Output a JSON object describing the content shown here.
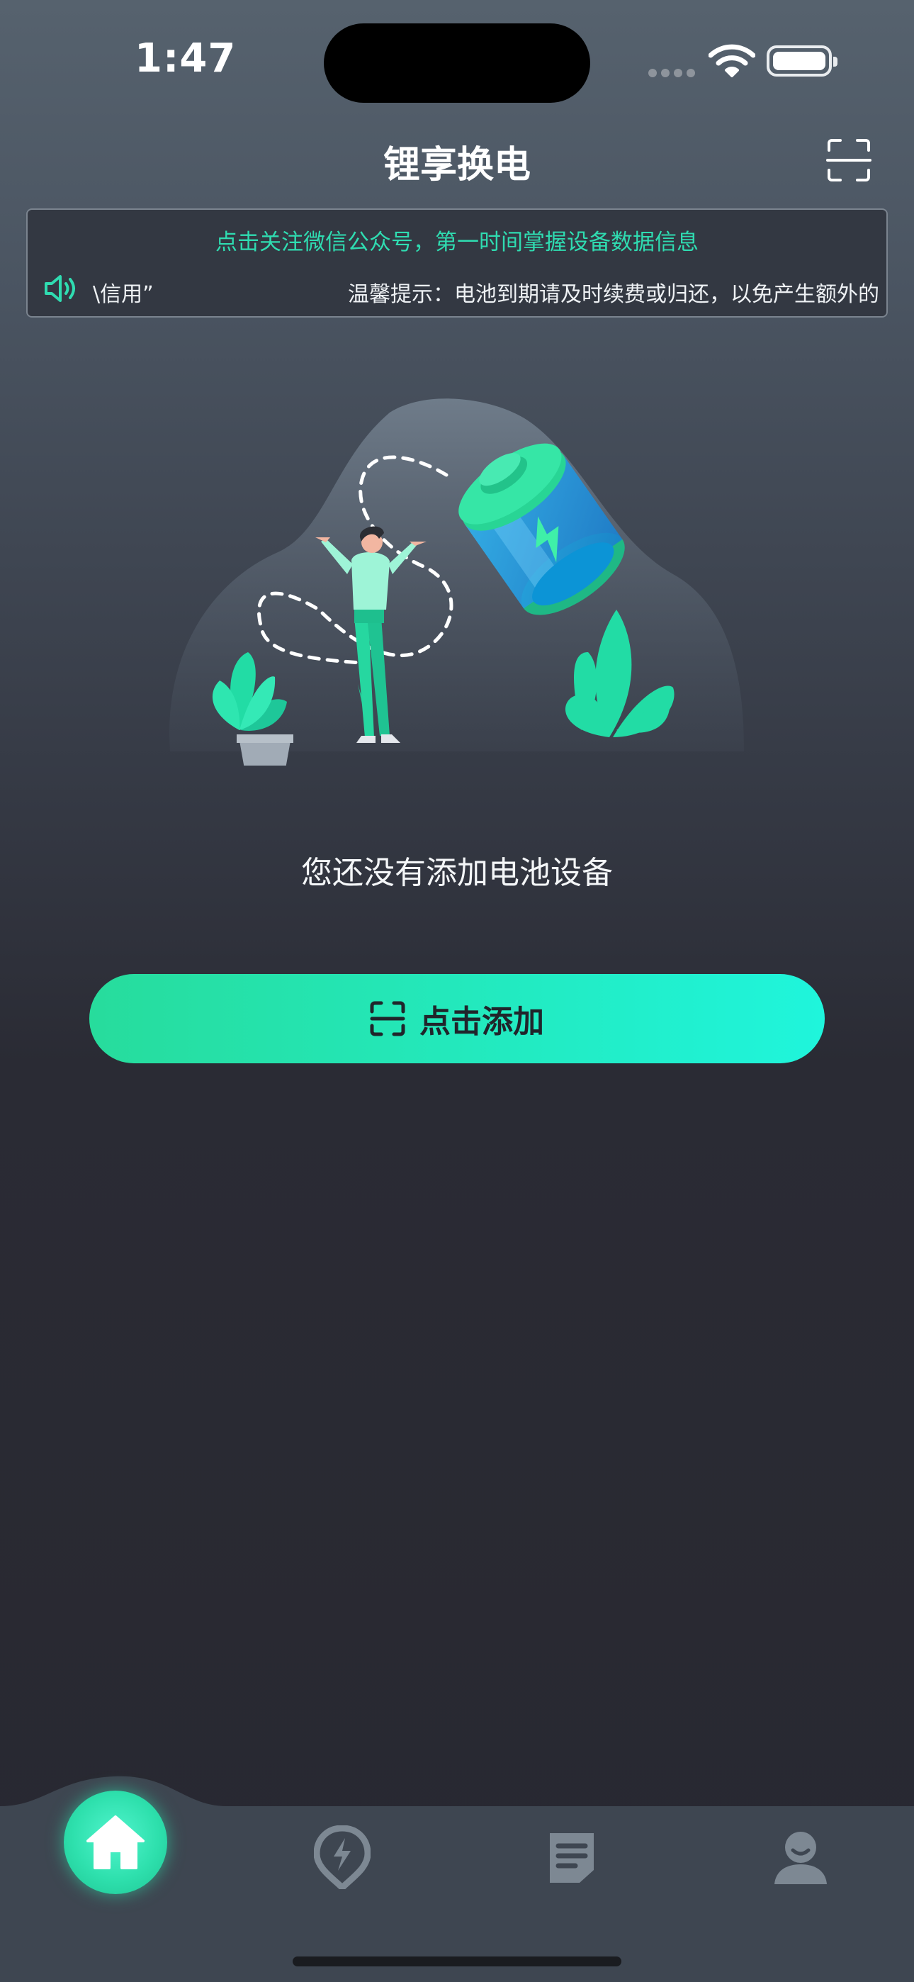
{
  "status_bar": {
    "time": "1:47"
  },
  "header": {
    "title": "锂享换电",
    "scan_icon": "scan-icon"
  },
  "notice": {
    "headline": "点击关注微信公众号，第一时间掌握设备数据信息",
    "scroll_tail": "\\信用”",
    "scroll_message": "温馨提示：电池到期请及时续费或归还，以免产生额外的",
    "speaker_icon": "speaker-icon"
  },
  "empty_state": {
    "illustration": "person-battery-illustration",
    "message": "您还没有添加电池设备"
  },
  "add_button": {
    "label": "点击添加",
    "icon": "scan-icon"
  },
  "tab_bar": {
    "tabs": [
      {
        "icon": "home-icon",
        "active": true
      },
      {
        "icon": "charging-station-icon",
        "active": false
      },
      {
        "icon": "orders-icon",
        "active": false
      },
      {
        "icon": "profile-icon",
        "active": false
      }
    ]
  },
  "colors": {
    "accent": "#2ee0ad",
    "accent_end": "#1ff5dc",
    "background_top": "#56626e",
    "background_bottom": "#282831",
    "tabbar": "#3e4651",
    "tab_inactive": "#7d8893"
  }
}
